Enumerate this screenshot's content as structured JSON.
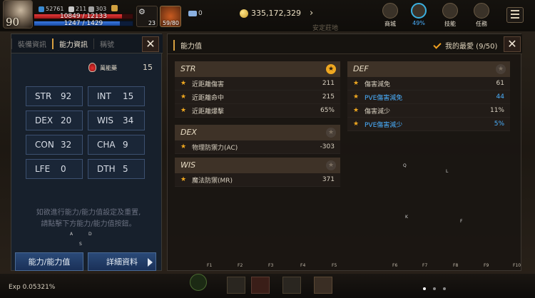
{
  "hud": {
    "level": "90",
    "mini_stats": [
      "52761",
      "211",
      "303"
    ],
    "hp_text": "10849 / 12133",
    "hp_fraction": 0.894,
    "mp_text": "1247 / 1429",
    "mp_fraction": 0.873,
    "slot1_count": "23",
    "slot2_count": "59/80",
    "wing_count": "0",
    "gold": "335,172,329",
    "icons": [
      {
        "label": "商城",
        "icon": "shop-icon"
      },
      {
        "label": "49%",
        "icon": "progress-ring-icon"
      },
      {
        "label": "技能",
        "icon": "skill-icon"
      },
      {
        "label": "任務",
        "icon": "quest-icon"
      }
    ],
    "bg_text": "安定莊地"
  },
  "left_panel": {
    "tabs": [
      "裝備資訊",
      "能力資訊",
      "稱號"
    ],
    "active_tab": 1,
    "potion_label": "萬能藥",
    "potion_value": "15",
    "stats": [
      {
        "name": "STR",
        "value": "92"
      },
      {
        "name": "INT",
        "value": "15"
      },
      {
        "name": "DEX",
        "value": "20"
      },
      {
        "name": "WIS",
        "value": "34"
      },
      {
        "name": "CON",
        "value": "32"
      },
      {
        "name": "CHA",
        "value": "9"
      },
      {
        "name": "LFE",
        "value": "0"
      },
      {
        "name": "DTH",
        "value": "5"
      }
    ],
    "help_line1": "如欲進行能力/能力值設定及重置,",
    "help_line2": "請點擊下方能力/能力值按鈕。",
    "btn_ability": "能力/能力值",
    "btn_detail": "詳細資料"
  },
  "right_panel": {
    "title": "能力值",
    "favorite_label": "我的最愛 (9/50)",
    "sections": [
      {
        "name": "STR",
        "starred": true,
        "rows": [
          {
            "label": "近距離傷害",
            "value": "211",
            "blue": false
          },
          {
            "label": "近距離命中",
            "value": "215",
            "blue": false
          },
          {
            "label": "近距離爆擊",
            "value": "65%",
            "blue": false
          }
        ]
      },
      {
        "name": "DEX",
        "starred": false,
        "rows": [
          {
            "label": "物理防禦力(AC)",
            "value": "-303",
            "blue": false
          }
        ]
      },
      {
        "name": "WIS",
        "starred": false,
        "rows": [
          {
            "label": "魔法防禦(MR)",
            "value": "371",
            "blue": false
          }
        ]
      },
      {
        "name": "DEF",
        "starred": false,
        "rows": [
          {
            "label": "傷害減免",
            "value": "61",
            "blue": false
          },
          {
            "label": "PVE傷害減免",
            "value": "44",
            "blue": true
          },
          {
            "label": "傷害減少",
            "value": "11%",
            "blue": false
          },
          {
            "label": "PVE傷害減少",
            "value": "5%",
            "blue": true
          }
        ]
      }
    ]
  },
  "bottom": {
    "exp": "Exp 0.05321%",
    "fkeys": [
      "F1",
      "F2",
      "F3",
      "F4",
      "F5",
      "F6",
      "F7",
      "F8",
      "F9",
      "F10"
    ],
    "key_letters": [
      "Q",
      "L",
      "K",
      "F",
      "A",
      "D",
      "S"
    ]
  }
}
